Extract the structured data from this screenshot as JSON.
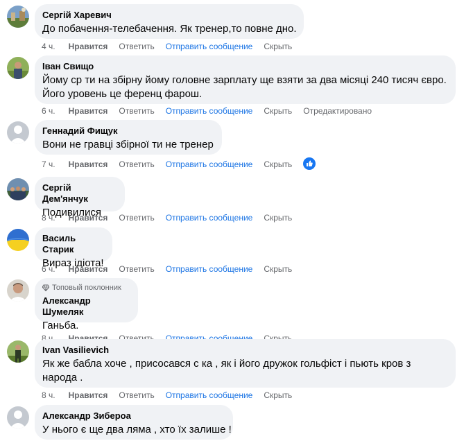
{
  "actions": {
    "like": "Нравится",
    "reply": "Ответить",
    "message": "Отправить сообщение",
    "hide": "Скрыть",
    "edited": "Отредактировано"
  },
  "comments": [
    {
      "author": "Сергій Харевич",
      "lines": [
        "До побачення-телебачення. Як тренер,то повне дно."
      ],
      "time": "4 ч.",
      "avatar": "avatar-landscape"
    },
    {
      "author": "Іван Свищо",
      "lines": [
        "Йому ср  ти на збірну йому головне зарплату ще взяти за два місяці 240 тисяч євро.",
        "Його уровень це ференц фарош."
      ],
      "time": "6 ч.",
      "avatar": "avatar-person-outdoor",
      "edited": true
    },
    {
      "author": "Геннадий Фищук",
      "lines": [
        "Вони не гравці збірної ти не тренер"
      ],
      "time": "7 ч.",
      "avatar": "avatar-default",
      "reaction": "like-reaction"
    },
    {
      "author": "Сергій Дем'янчук",
      "lines": [
        "Подивилися"
      ],
      "time": "8 ч.",
      "avatar": "avatar-group"
    },
    {
      "author": "Василь Старик",
      "lines": [
        "Вираз ідіота!"
      ],
      "time": "6 ч.",
      "avatar": "avatar-flag"
    },
    {
      "author": "Александр Шумеляк",
      "badge": "Топовый поклонник",
      "lines": [
        "Ганьба."
      ],
      "time": "8 ч.",
      "avatar": "avatar-portrait"
    },
    {
      "author": "Ivan Vasilievich",
      "lines": [
        "Як же бабла хоче , присосався с  ка , як і його дружок гольфіст і пьють кров з",
        "народа ."
      ],
      "time": "8 ч.",
      "avatar": "avatar-person-green"
    },
    {
      "author": "Александр Зибероа",
      "lines": [
        "У нього є ще два ляма , хто їх залише !"
      ],
      "avatar": "avatar-default"
    }
  ],
  "colors": {
    "bubble": "#f0f2f5",
    "action_text": "#65676b",
    "message_link": "#1b74e4",
    "like_reaction": "#1877f2"
  }
}
